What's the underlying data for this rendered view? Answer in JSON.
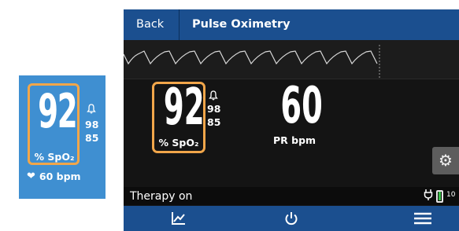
{
  "tile": {
    "spo2_value": "92",
    "spo2_unit": "% SpO₂",
    "alarm_high": "98",
    "alarm_low": "85",
    "pulse_rate": "60 bpm"
  },
  "header": {
    "back_label": "Back",
    "title": "Pulse Oximetry"
  },
  "main": {
    "spo2_value": "92",
    "spo2_unit": "% SpO₂",
    "alarm_high": "98",
    "alarm_low": "85",
    "pr_value": "60",
    "pr_unit": "PR bpm"
  },
  "status": {
    "therapy": "Therapy on",
    "battery_text": "10"
  },
  "icons": {
    "bell": "bell-icon",
    "heart": "heart-icon",
    "gear": "gear-icon",
    "plug": "plug-icon",
    "battery": "battery-icon",
    "trend": "trend-chart-icon",
    "power": "power-icon",
    "menu": "menu-icon"
  },
  "colors": {
    "tile_bg": "#3f8fd1",
    "highlight": "#f1a64a",
    "header_bg": "#1b4f8f",
    "screen_bg": "#141414",
    "battery_fill": "#3cc04a"
  }
}
